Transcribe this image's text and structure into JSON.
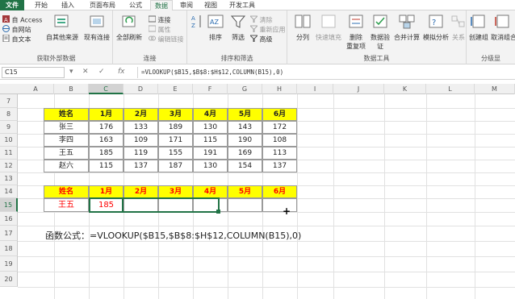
{
  "tabs": [
    "文件",
    "开始",
    "插入",
    "页面布局",
    "公式",
    "数据",
    "审阅",
    "视图",
    "开发工具"
  ],
  "ribbon": {
    "get_external": {
      "items": [
        "自 Access",
        "自网站",
        "自文本"
      ],
      "other_sources": "自其他来源",
      "existing": "现有连接",
      "label": "获取外部数据"
    },
    "connections": {
      "refresh_all": "全部刷新",
      "items": [
        "连接",
        "属性",
        "编辑链接"
      ],
      "label": "连接"
    },
    "sort_filter": {
      "sort": "排序",
      "filter": "筛选",
      "items": [
        "清除",
        "重新应用",
        "高级"
      ],
      "label": "排序和筛选"
    },
    "data_tools": {
      "split": "分列",
      "flash_fill": "快速填充",
      "remove_dup_1": "删除",
      "remove_dup_2": "重复项",
      "validation_1": "数据验",
      "validation_2": "证",
      "consolidate": "合并计算",
      "what_if": "模拟分析",
      "relationships": "关系",
      "label": "数据工具"
    },
    "outline": {
      "group": "创建组",
      "ungroup": "取消组合",
      "label": "分级显"
    }
  },
  "formula_bar": {
    "name_box": "C15",
    "fx": "fx",
    "formula": "=VLOOKUP($B15,$B$8:$H$12,COLUMN(B15),0)"
  },
  "columns": [
    "A",
    "B",
    "C",
    "D",
    "E",
    "F",
    "G",
    "H",
    "I",
    "J",
    "K",
    "L",
    "M"
  ],
  "rows": [
    "7",
    "8",
    "9",
    "10",
    "11",
    "12",
    "13",
    "14",
    "15",
    "16",
    "17",
    "18",
    "19",
    "20"
  ],
  "table1": {
    "headers": [
      "姓名",
      "1月",
      "2月",
      "3月",
      "4月",
      "5月",
      "6月"
    ],
    "rows": [
      [
        "张三",
        "176",
        "133",
        "189",
        "130",
        "143",
        "172"
      ],
      [
        "李四",
        "163",
        "109",
        "171",
        "115",
        "190",
        "108"
      ],
      [
        "王五",
        "185",
        "119",
        "155",
        "191",
        "169",
        "113"
      ],
      [
        "赵六",
        "115",
        "137",
        "187",
        "130",
        "154",
        "137"
      ]
    ]
  },
  "table2": {
    "headers": [
      "姓名",
      "1月",
      "2月",
      "3月",
      "4月",
      "5月",
      "6月"
    ],
    "row": [
      "王五",
      "185",
      "",
      "",
      "",
      "",
      ""
    ]
  },
  "formula_note": "函数公式：=VLOOKUP($B15,$B$8:$H$12,COLUMN(B15),0)",
  "colors": {
    "excel_green": "#217346",
    "header_yellow": "#ffff00",
    "red_text": "#ff0000"
  }
}
